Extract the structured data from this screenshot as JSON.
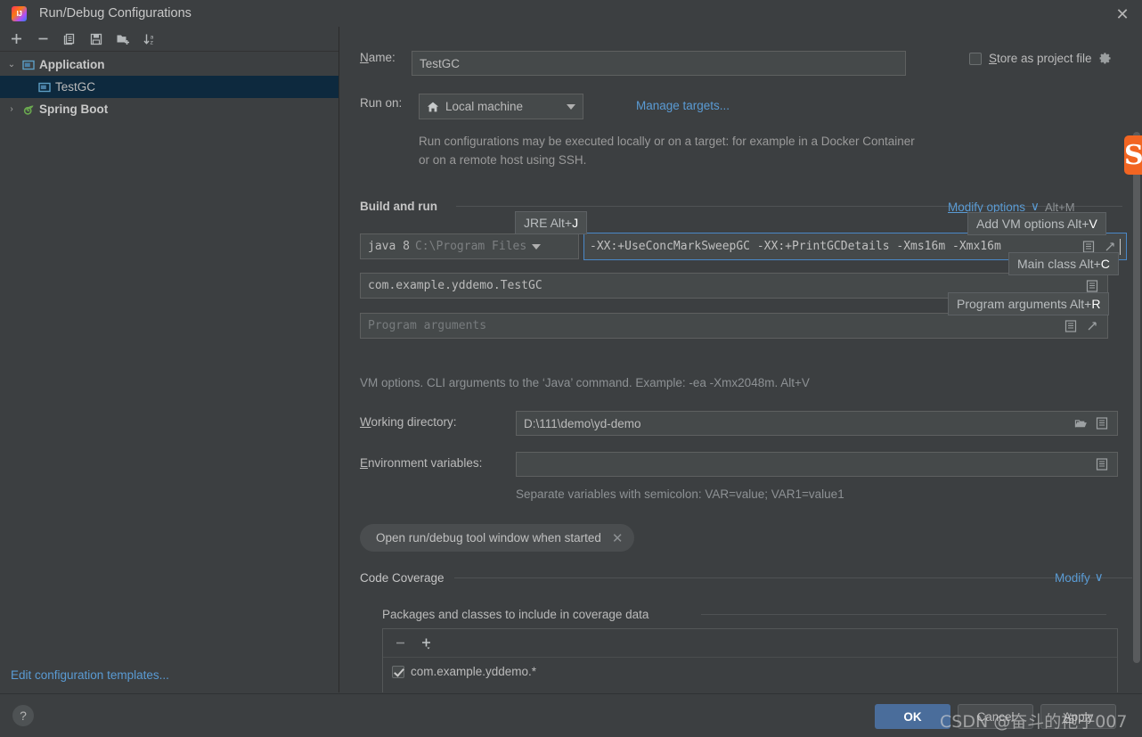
{
  "window": {
    "title": "Run/Debug Configurations",
    "logo_icon": "intellij-idea-logo",
    "close_icon": "close-icon"
  },
  "toolbar": {
    "buttons": [
      {
        "name": "add",
        "icon": "plus-icon"
      },
      {
        "name": "remove",
        "icon": "minus-icon"
      },
      {
        "name": "copy",
        "icon": "copy-icon"
      },
      {
        "name": "save",
        "icon": "save-icon"
      },
      {
        "name": "new-folder",
        "icon": "folder-add-icon"
      },
      {
        "name": "sort-alphabetically",
        "icon": "sort-az-icon"
      }
    ]
  },
  "sidebar": {
    "items": [
      {
        "label": "Application",
        "icon": "application-icon",
        "arrow": "⌄",
        "selected": false,
        "bold": true
      },
      {
        "label": "TestGC",
        "icon": "application-icon",
        "arrow": "",
        "selected": true,
        "bold": false
      },
      {
        "label": "Spring Boot",
        "icon": "spring-boot-icon",
        "arrow": "›",
        "selected": false,
        "bold": true
      }
    ],
    "edit_templates_link": "Edit configuration templates..."
  },
  "form": {
    "name_label": "Name:",
    "name_value": "TestGC",
    "store_as_project_file_label": "Store as project file",
    "store_as_project_file_checked": false,
    "store_gear_icon": "gear-icon",
    "run_on_label": "Run on:",
    "run_on_value": "Local machine",
    "run_on_icon": "home-icon",
    "manage_targets_link": "Manage targets...",
    "description": "Run configurations may be executed locally or on a target: for example in a Docker Container or on a remote host using SSH."
  },
  "build_and_run": {
    "section_title": "Build and run",
    "modify_options_link": "Modify options",
    "modify_options_chevron": "∨",
    "modify_options_shortcut": "Alt+M",
    "jre_name": "java 8",
    "jre_path": "C:\\Program Files",
    "vm_options_value": "-XX:+UseConcMarkSweepGC -XX:+PrintGCDetails -Xms16m -Xmx16m",
    "main_class_value": "com.example.yddemo.TestGC",
    "program_arguments_placeholder": "Program arguments",
    "vm_hint": "VM options. CLI arguments to the ‘Java’ command. Example: -ea -Xmx2048m. Alt+V",
    "list_icon": "list-icon",
    "expand_icon": "expand-icon"
  },
  "tooltips": [
    {
      "name": "jre-tooltip",
      "text": "JRE Alt+",
      "key": "J"
    },
    {
      "name": "add-vm-options-tooltip",
      "text": "Add VM options Alt+",
      "key": "V"
    },
    {
      "name": "main-class-tooltip",
      "text": "Main class Alt+",
      "key": "C"
    },
    {
      "name": "program-arguments-tooltip",
      "text": "Program arguments Alt+",
      "key": "R"
    }
  ],
  "directories": {
    "working_directory_label": "Working directory:",
    "working_directory_value": "D:\\111\\demo\\yd-demo",
    "browse_icon": "folder-open-icon",
    "environment_variables_label": "Environment variables:",
    "environment_variables_value": "",
    "environment_hint": "Separate variables with semicolon: VAR=value; VAR1=value1"
  },
  "chip": {
    "label": "Open run/debug tool window when started",
    "close_icon": "close-icon"
  },
  "code_coverage": {
    "section_title": "Code Coverage",
    "modify_link": "Modify",
    "modify_chevron": "∨",
    "packages_title": "Packages and classes to include in coverage data",
    "remove_icon": "minus-icon",
    "add_icon": "plus-dropdown-icon",
    "items": [
      {
        "label": "com.example.yddemo.*",
        "checked": true
      }
    ]
  },
  "bottom_bar": {
    "help_icon": "?",
    "ok_label": "OK",
    "cancel_label": "Cancel",
    "apply_label": "Apply",
    "apply_mnemonic": "A"
  },
  "watermark": {
    "text": "CSDN @奋斗的袍子007"
  },
  "badge": {
    "text": "S"
  },
  "colors": {
    "background": "#3c3f41",
    "field": "#45494a",
    "accent_link": "#5a9bd4",
    "focus_border": "#4a88c7",
    "selection": "#0d293e",
    "primary_button": "#4a6d9b",
    "badge_orange": "#f26522"
  }
}
